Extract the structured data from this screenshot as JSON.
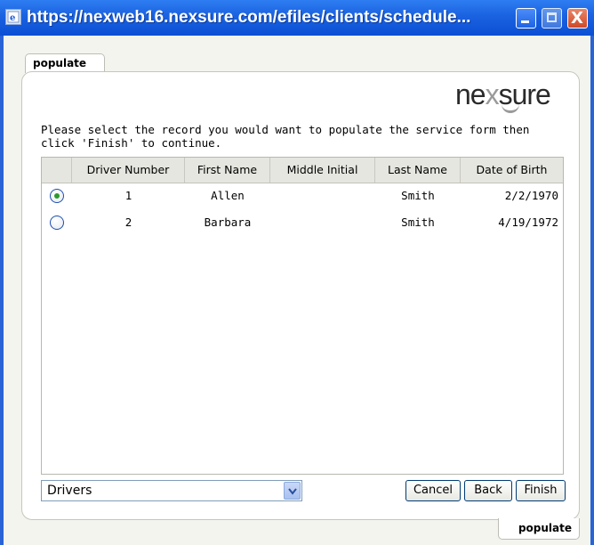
{
  "window": {
    "title": "https://nexweb16.nexsure.com/efiles/clients/schedule...",
    "controls": [
      "minimize",
      "maximize",
      "close"
    ],
    "close_glyph": "X"
  },
  "tabs": {
    "top_label": "populate",
    "bottom_label": "populate"
  },
  "logo": {
    "part1": "ne",
    "part2": "x",
    "part3": "sure"
  },
  "instructions": "Please select the record you would want to populate the service form then click 'Finish' to continue.",
  "grid": {
    "columns": [
      "",
      "Driver Number",
      "First Name",
      "Middle Initial",
      "Last Name",
      "Date of Birth"
    ],
    "rows": [
      {
        "selected": true,
        "driver_number": "1",
        "first_name": "Allen",
        "middle_initial": "",
        "last_name": "Smith",
        "date_of_birth": "2/2/1970"
      },
      {
        "selected": false,
        "driver_number": "2",
        "first_name": "Barbara",
        "middle_initial": "",
        "last_name": "Smith",
        "date_of_birth": "4/19/1972"
      }
    ]
  },
  "record_type_select": {
    "value": "Drivers"
  },
  "buttons": {
    "cancel": "Cancel",
    "back": "Back",
    "finish": "Finish"
  },
  "colors": {
    "titlebar": "#1a62e0",
    "radio_selected": "#2b9a2b",
    "window_border": "#2a63d6"
  },
  "icons": [
    "ie-page-icon",
    "minimize-icon",
    "maximize-icon",
    "close-icon",
    "dropdown-arrow-icon",
    "radio-button"
  ]
}
